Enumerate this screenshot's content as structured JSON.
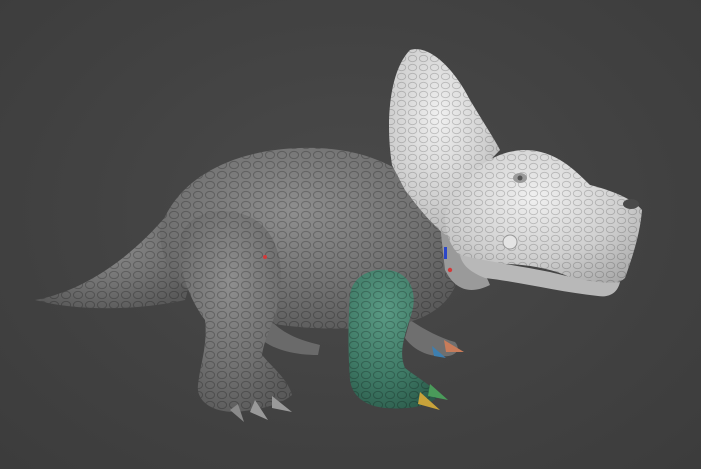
{
  "viewport": {
    "background_color": "#424242",
    "model": {
      "subject": "triceratops-sculpt",
      "body_color": "#7c7c7c",
      "head_color": "#cfcfcf",
      "masked_leg_color": "#3f7a66",
      "marker_colors": [
        "#d23a3a",
        "#2b47c9",
        "#3d7fb0",
        "#c8a23a",
        "#4a9b5a",
        "#c87c5a"
      ]
    }
  }
}
